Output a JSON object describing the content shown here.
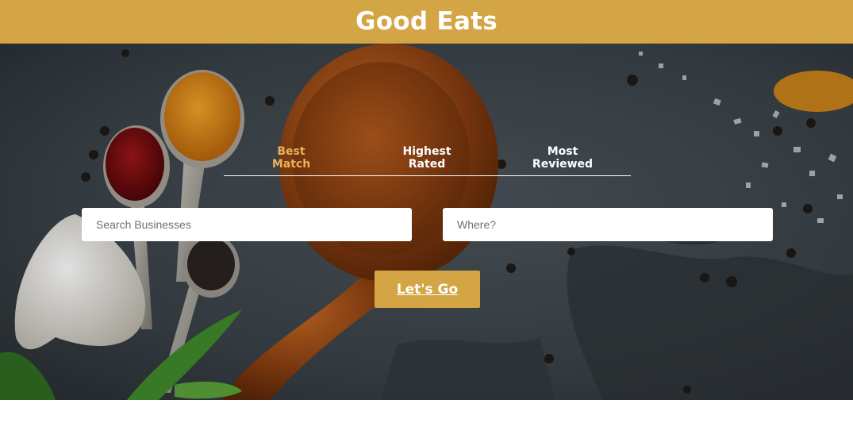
{
  "header": {
    "title": "Good Eats"
  },
  "sort_options": [
    {
      "line1": "Best",
      "line2": "Match",
      "active": true
    },
    {
      "line1": "Highest",
      "line2": "Rated",
      "active": false
    },
    {
      "line1": "Most",
      "line2": "Reviewed",
      "active": false
    }
  ],
  "search": {
    "business_placeholder": "Search Businesses",
    "location_placeholder": "Where?",
    "submit_label": "Let's Go"
  },
  "colors": {
    "brand": "#d4a544",
    "active_tab": "#e7b25a",
    "hero_background": "#3a4248"
  }
}
